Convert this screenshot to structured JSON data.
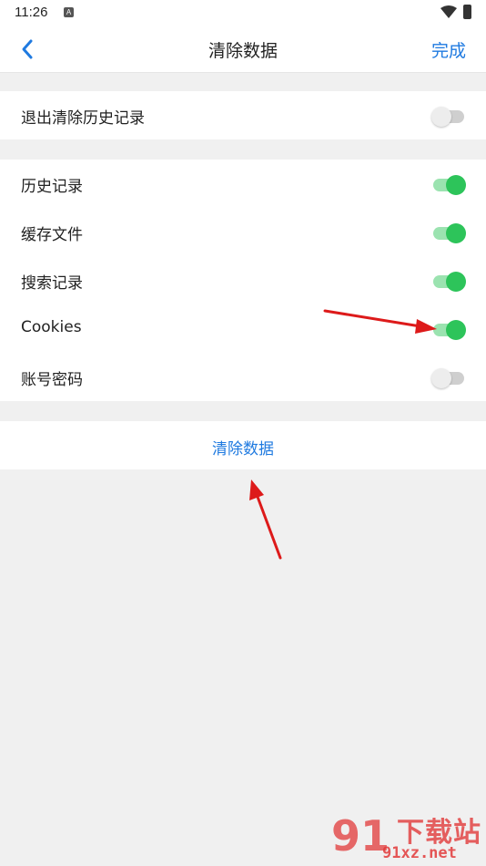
{
  "status": {
    "time": "11:26",
    "notification_glyph": "A"
  },
  "header": {
    "title": "清除数据",
    "done_label": "完成"
  },
  "section_exit": {
    "items": [
      {
        "label": "退出清除历史记录",
        "enabled": false
      }
    ]
  },
  "section_items": {
    "items": [
      {
        "label": "历史记录",
        "enabled": true
      },
      {
        "label": "缓存文件",
        "enabled": true
      },
      {
        "label": "搜索记录",
        "enabled": true
      },
      {
        "label": "Cookies",
        "enabled": true
      },
      {
        "label": "账号密码",
        "enabled": false
      }
    ]
  },
  "clear_button_label": "清除数据",
  "watermark": {
    "logo_text": "91",
    "brand": "下载站",
    "site": "91xz.net"
  },
  "colors": {
    "accent": "#1f7ae0",
    "toggle_on": "#2dc45a",
    "toggle_on_track": "#9be3b0",
    "annotation_arrow": "#dd1a1a"
  }
}
